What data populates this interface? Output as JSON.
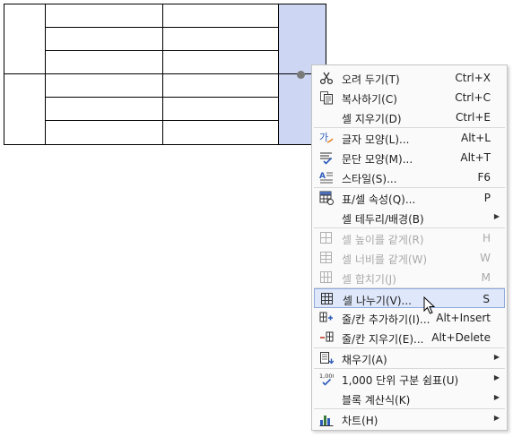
{
  "menu": {
    "items": [
      {
        "label": "오려 두기(T)",
        "shortcut": "Ctrl+X",
        "icon": "scissors-icon"
      },
      {
        "label": "복사하기(C)",
        "shortcut": "Ctrl+C",
        "icon": "copy-icon"
      },
      {
        "label": "셀 지우기(D)",
        "shortcut": "Ctrl+E",
        "icon": ""
      },
      {
        "label": "글자 모양(L)...",
        "shortcut": "Alt+L",
        "icon": "char-shape-icon"
      },
      {
        "label": "문단 모양(M)...",
        "shortcut": "Alt+T",
        "icon": "paragraph-shape-icon"
      },
      {
        "label": "스타일(S)...",
        "shortcut": "F6",
        "icon": "style-icon"
      },
      {
        "label": "표/셀 속성(Q)...",
        "shortcut": "P",
        "icon": "table-props-icon"
      },
      {
        "label": "셀 테두리/배경(B)",
        "shortcut": "",
        "icon": "",
        "submenu": true
      },
      {
        "label": "셀 높이를 같게(R)",
        "shortcut": "H",
        "icon": "equal-height-icon",
        "disabled": true
      },
      {
        "label": "셀 너비를 같게(W)",
        "shortcut": "W",
        "icon": "equal-width-icon",
        "disabled": true
      },
      {
        "label": "셀 합치기(J)",
        "shortcut": "M",
        "icon": "merge-cells-icon",
        "disabled": true
      },
      {
        "label": "셀 나누기(V)...",
        "shortcut": "S",
        "icon": "split-cells-icon",
        "highlighted": true
      },
      {
        "label": "줄/칸 추가하기(I)...",
        "shortcut": "Alt+Insert",
        "icon": "insert-row-col-icon"
      },
      {
        "label": "줄/칸 지우기(E)...",
        "shortcut": "Alt+Delete",
        "icon": "delete-row-col-icon"
      },
      {
        "label": "채우기(A)",
        "shortcut": "",
        "icon": "fill-icon",
        "submenu": true
      },
      {
        "label": "1,000 단위 구분 쉼표(U)",
        "shortcut": "",
        "icon": "thousand-separator-icon",
        "submenu": true
      },
      {
        "label": "블록 계산식(K)",
        "shortcut": "",
        "icon": "",
        "submenu": true
      },
      {
        "label": "차트(H)",
        "shortcut": "",
        "icon": "chart-icon",
        "submenu": true
      }
    ],
    "submenu_arrow": "▶",
    "separator_after": [
      2,
      5,
      7,
      10,
      13,
      14,
      16
    ]
  }
}
